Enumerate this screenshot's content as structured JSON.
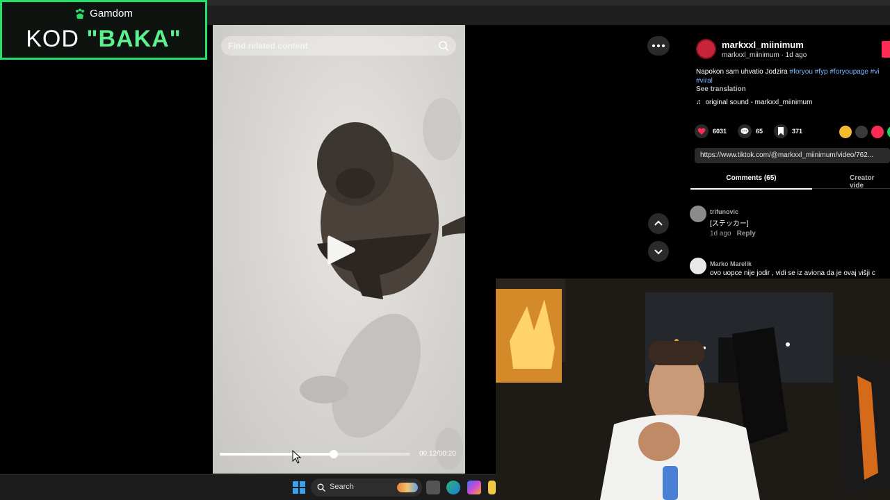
{
  "promo": {
    "brand": "Gamdom",
    "code_prefix": "KOD ",
    "code_value": "\"BAKA\"",
    "accent_color": "#27e06a"
  },
  "video": {
    "search_placeholder": "Find related content",
    "time": "00:12/00:20",
    "progress_fraction": 0.6,
    "play_icon": "play-icon"
  },
  "post": {
    "display_name": "markxxl_miinimum",
    "sub_line": "markxxl_miinimum · 1d ago",
    "caption_text": "Napokon sam uhvatio Jodzira ",
    "hashtags": [
      "#foryou",
      "#fyp",
      "#foryoupage",
      "#vi",
      "#viral"
    ],
    "see_translation": "See translation",
    "sound": "original sound - markxxl_miinimum",
    "likes": "6031",
    "comments": "65",
    "saves": "371",
    "link": "https://www.tiktok.com/@markxxl_miinimum/video/762..."
  },
  "tabs": {
    "comments": "Comments (65)",
    "creator": "Creator vide"
  },
  "comments": [
    {
      "user": "trifunovic",
      "text": "[ステッカー]",
      "time": "1d ago",
      "reply": "Reply"
    },
    {
      "user": "Marko Marelik",
      "text": "ovo uopce nije jodir , vidi se iz aviona da je ovaj višji c"
    }
  ],
  "taskbar": {
    "search_label": "Search"
  },
  "colors": {
    "tiktok_red": "#fe2c55",
    "hashtag_blue": "#7ab6ff"
  }
}
